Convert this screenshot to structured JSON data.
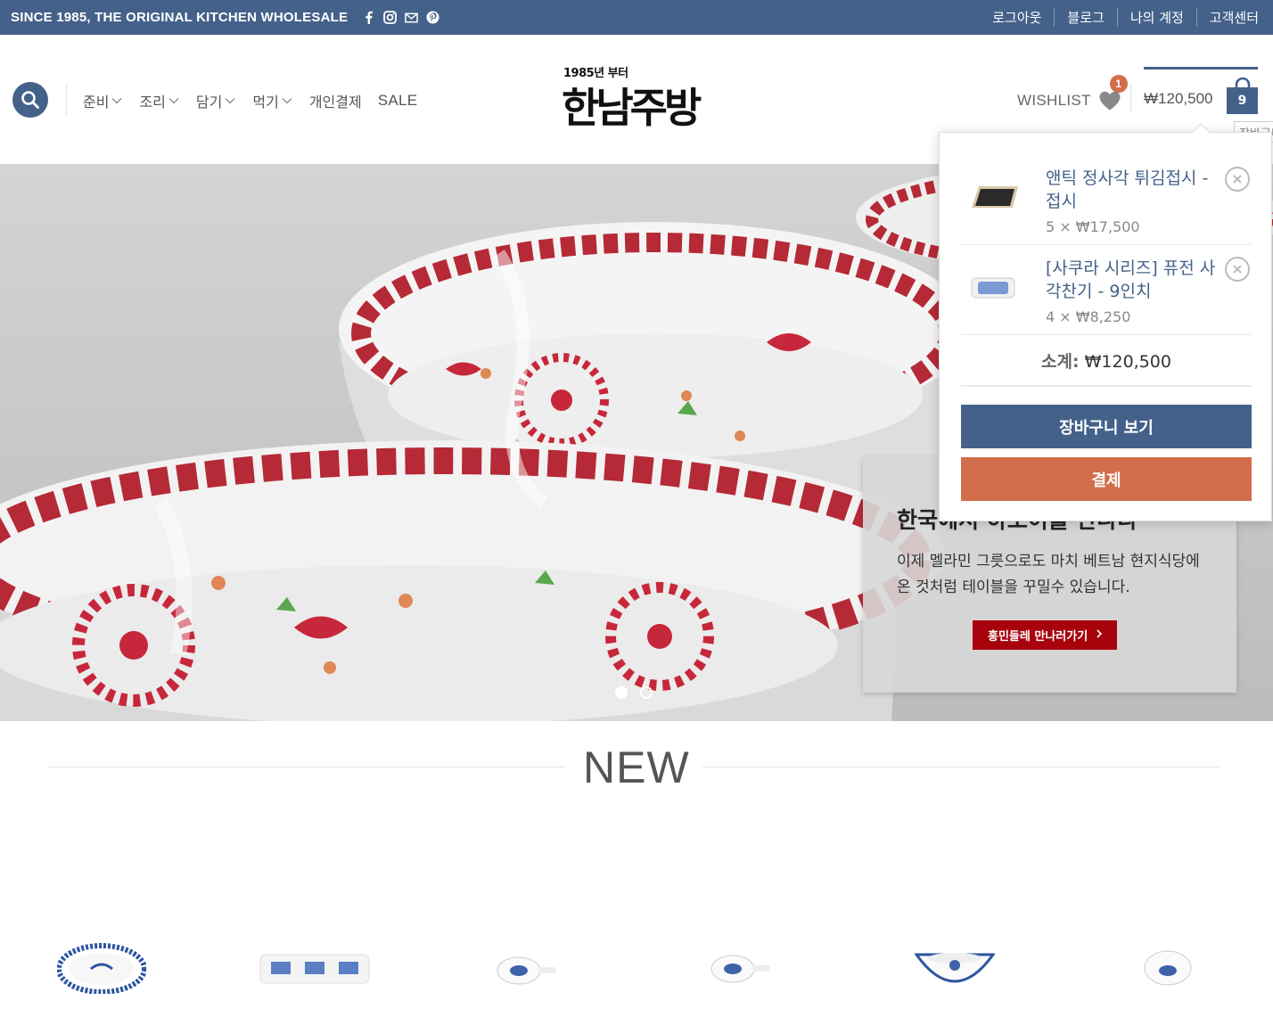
{
  "topbar": {
    "tagline": "SINCE 1985, THE ORIGINAL KITCHEN WHOLESALE",
    "social_icons": [
      "facebook-icon",
      "instagram-icon",
      "mail-icon",
      "pinterest-icon"
    ],
    "links": [
      "로그아웃",
      "블로그",
      "나의 계정",
      "고객센터"
    ]
  },
  "nav": {
    "items": [
      {
        "label": "준비",
        "has_dropdown": true
      },
      {
        "label": "조리",
        "has_dropdown": true
      },
      {
        "label": "담기",
        "has_dropdown": true
      },
      {
        "label": "먹기",
        "has_dropdown": true
      },
      {
        "label": "개인결제",
        "has_dropdown": false
      },
      {
        "label": "SALE",
        "has_dropdown": false
      }
    ]
  },
  "logo": {
    "small_text": "1985년 부터",
    "main_text": "한남주방"
  },
  "header": {
    "wishlist_label": "WISHLIST",
    "wishlist_count": "1",
    "cart_total": "₩120,500",
    "cart_count": "9",
    "cart_tooltip": "장바구니"
  },
  "hero": {
    "heading": "한국에서 하노이를 만나다",
    "description": "이제 멜라민 그릇으로도 마치 베트남 현지식당에 온 것처럼 테이블을 꾸밀수 있습니다.",
    "cta": "홍민들레 만나러가기",
    "slides": 2,
    "active_slide": 1
  },
  "minicart": {
    "items": [
      {
        "name": "앤틱 정사각 튀김접시 - 접시",
        "qty": "5",
        "price": "₩17,500"
      },
      {
        "name": "[사쿠라 시리즈] 퓨전 사각찬기 - 9인치",
        "qty": "4",
        "price": "₩8,250"
      }
    ],
    "times": "×",
    "subtotal_label": "소계:",
    "subtotal_value": "₩120,500",
    "view_cart": "장바구니 보기",
    "checkout": "결제"
  },
  "new_section": {
    "title": "NEW"
  },
  "colors": {
    "primary": "#44618a",
    "accent": "#d26e4b",
    "cta_red": "#a8020d"
  }
}
